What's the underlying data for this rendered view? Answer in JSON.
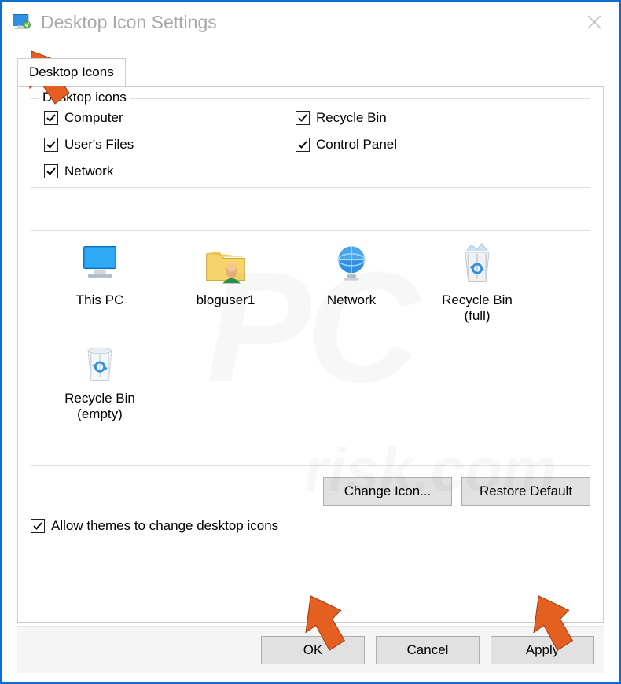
{
  "title": "Desktop Icon Settings",
  "tab_label": "Desktop Icons",
  "group_label": "Desktop icons",
  "checks_left": [
    {
      "label": "Computer",
      "checked": true
    },
    {
      "label": "User's Files",
      "checked": true
    },
    {
      "label": "Network",
      "checked": true
    }
  ],
  "checks_right": [
    {
      "label": "Recycle Bin",
      "checked": true
    },
    {
      "label": "Control Panel",
      "checked": true
    }
  ],
  "preview_icons": [
    {
      "name": "this-pc-icon",
      "label": "This PC"
    },
    {
      "name": "user-folder-icon",
      "label": "bloguser1"
    },
    {
      "name": "network-icon",
      "label": "Network"
    },
    {
      "name": "recycle-bin-full-icon",
      "label": "Recycle Bin\n(full)"
    },
    {
      "name": "recycle-bin-empty-icon",
      "label": "Recycle Bin\n(empty)"
    }
  ],
  "change_icon_label": "Change Icon...",
  "restore_default_label": "Restore Default",
  "themes_label": "Allow themes to change desktop icons",
  "themes_checked": true,
  "ok_label": "OK",
  "cancel_label": "Cancel",
  "apply_label": "Apply",
  "watermark_main": "PC",
  "watermark_sub": "risk.com"
}
